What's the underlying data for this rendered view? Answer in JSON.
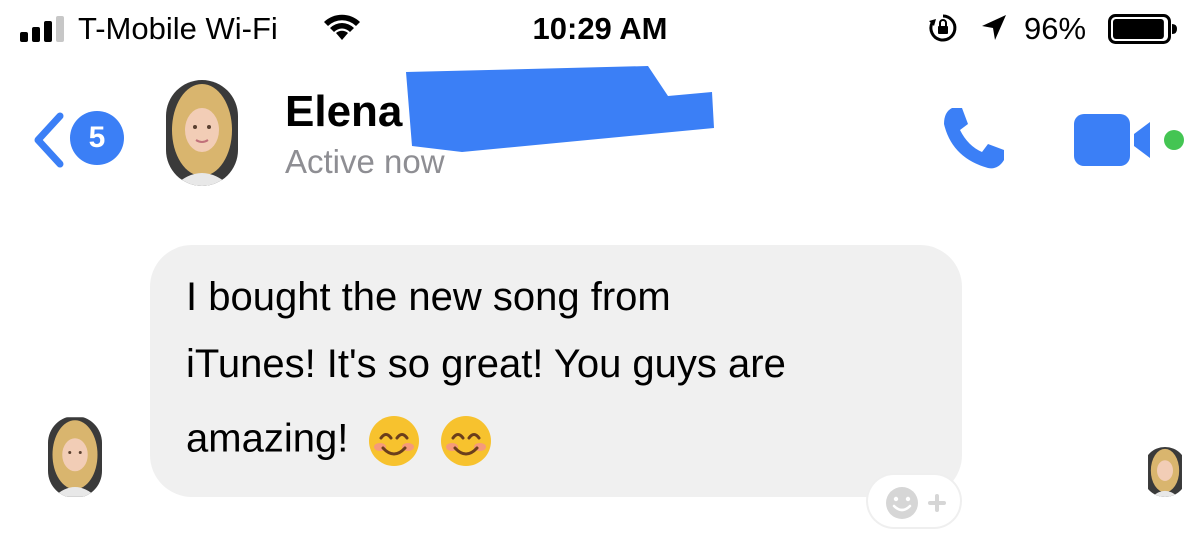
{
  "status_bar": {
    "carrier": "T-Mobile Wi-Fi",
    "time": "10:29 AM",
    "battery_percent": "96%",
    "signal_bars": 4,
    "signal_bars_filled": 3,
    "battery_level": 0.96,
    "icons": [
      "signal-icon",
      "wifi-icon",
      "orientation-lock-icon",
      "location-icon",
      "battery-icon"
    ]
  },
  "header": {
    "back_badge_count": "5",
    "contact_name": "Elena",
    "active_status": "Active now",
    "icons": [
      "back-chevron-icon",
      "phone-icon",
      "video-camera-icon",
      "online-dot-icon"
    ]
  },
  "conversation": {
    "message": {
      "lines": [
        "I bought the new song from",
        "iTunes! It's so great! You guys are",
        "amazing!"
      ],
      "emojis": [
        "😊",
        "😊"
      ]
    },
    "reaction_button_icons": [
      "smiley-icon",
      "plus-icon"
    ]
  },
  "colors": {
    "accent": "#3b7ff6",
    "online": "#44c553",
    "bubble": "#f0f0f0",
    "secondary_text": "#8e8e93"
  }
}
